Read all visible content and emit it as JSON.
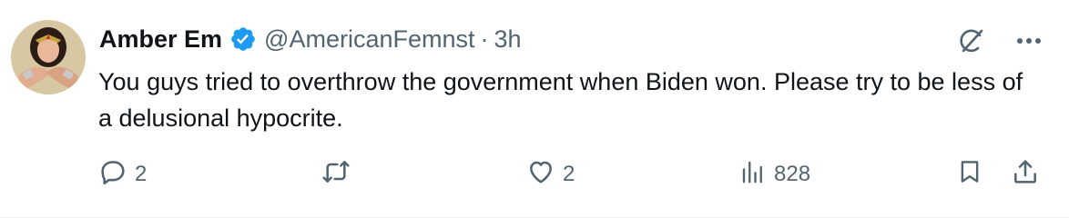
{
  "author": {
    "display_name": "Amber Em",
    "handle": "@AmericanFemnst",
    "separator": "·",
    "timestamp": "3h",
    "verified": true
  },
  "tweet": {
    "text": "You guys tried to overthrow the government when Biden won. Please try to be less of a delusional hypocrite."
  },
  "actions": {
    "reply_count": "2",
    "retweet_count": "",
    "like_count": "2",
    "views_count": "828"
  },
  "icons": {
    "verified": "verified-badge-icon",
    "grok": "grok-icon",
    "more": "more-icon",
    "reply": "reply-icon",
    "retweet": "retweet-icon",
    "like": "heart-icon",
    "views": "views-icon",
    "bookmark": "bookmark-icon",
    "share": "share-icon"
  },
  "colors": {
    "text_primary": "#0f1419",
    "text_secondary": "#536471",
    "verified_blue": "#1d9bf0",
    "border": "#eff3f4"
  }
}
